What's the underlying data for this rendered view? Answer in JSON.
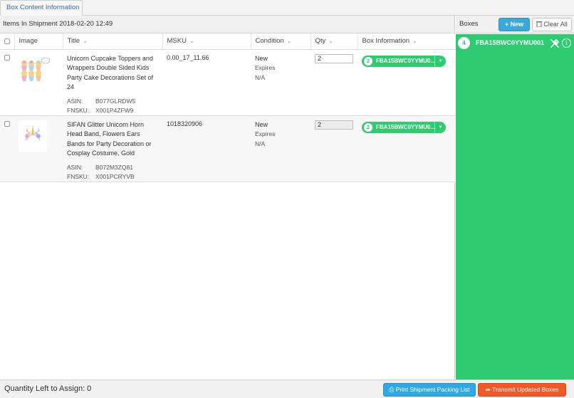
{
  "tabs": {
    "box_content_label": "Box Content Information"
  },
  "items_panel": {
    "header": "Items In Shipment 2018-02-20 12:49",
    "columns": {
      "image": "Image",
      "title": "Title",
      "msku": "MSKU",
      "condition": "Condition",
      "qty": "Qty",
      "box_info": "Box Information"
    },
    "rows": [
      {
        "title": "Unicorn Cupcake Toppers and Wrappers Double Sided Kids Party Cake Decorations Set of 24",
        "asin_label": "ASIN:",
        "asin": "B077GLRDW5",
        "fnsku_label": "FNSKU:",
        "fnsku": "X001P4ZFW9",
        "msku": "0.00_17_11.66",
        "condition": "New",
        "expires": "Expires",
        "expires_value": "N/A",
        "qty": "2",
        "box_count": "2",
        "box_label": "FBA15BWC0YYMU0..."
      },
      {
        "title": "SIFAN Glitter Unicorn Horn Head Band, Flowers Ears Bands for Party Decoration or Cosplay Costume, Gold",
        "asin_label": "ASIN:",
        "asin": "B072M3ZQ81",
        "fnsku_label": "FNSKU:",
        "fnsku": "X001PCRYVB",
        "msku": "1018320906",
        "condition": "New",
        "expires": "Expires",
        "expires_value": "N/A",
        "qty": "2",
        "box_count": "2",
        "box_label": "FBA15BWC0YYMU0..."
      }
    ]
  },
  "boxes_panel": {
    "title": "Boxes",
    "new_label": "+ New",
    "clear_label": "Clear All",
    "box": {
      "count": "4",
      "label": "FBA15BWC0YYMU001",
      "info": "i"
    }
  },
  "footer": {
    "quantity_left": "Quantity Left to Assign: 0",
    "print_label": "Print Shipment Packing List",
    "transmit_label": "Transmit Updated Boxes"
  },
  "colors": {
    "accent_green": "#2ecc71",
    "accent_blue": "#2fa9e0",
    "accent_orange": "#f05a28"
  }
}
